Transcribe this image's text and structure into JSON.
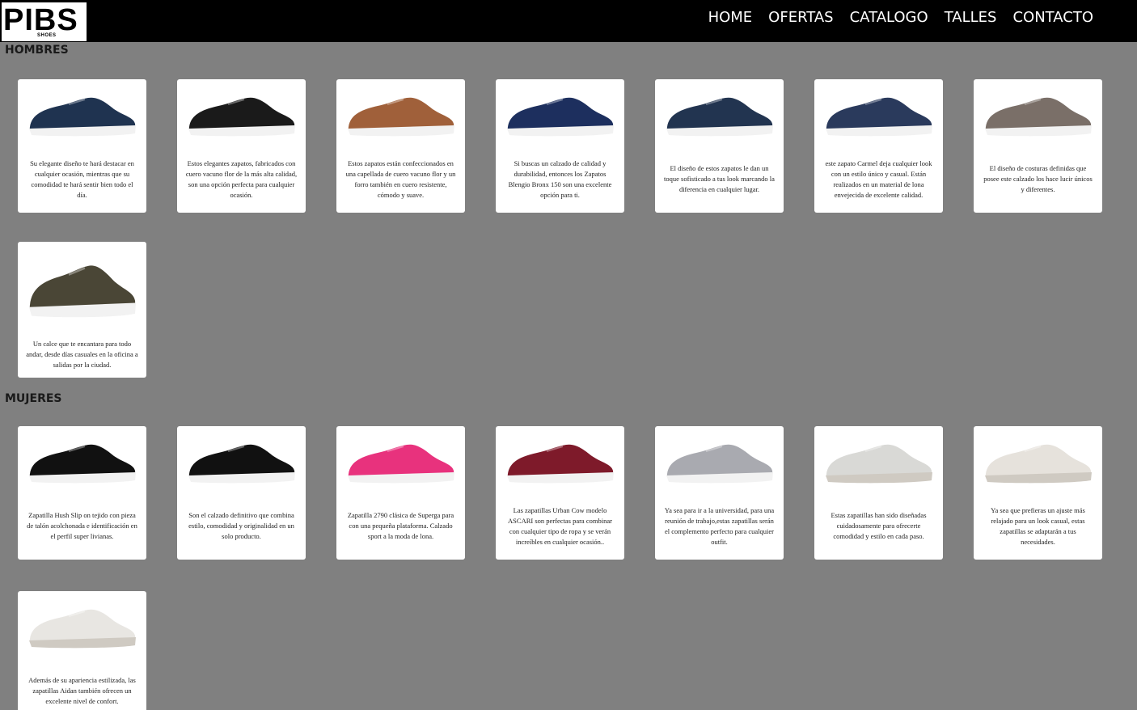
{
  "brand": {
    "logo_text": "PIBS",
    "logo_sub": "SHOES"
  },
  "nav": [
    "HOME",
    "OFERTAS",
    "CATALOGO",
    "TALLES",
    "CONTACTO"
  ],
  "sections": {
    "men": {
      "title": "HOMBRES",
      "products": [
        {
          "desc": "Su elegante diseño te hará destacar en cualquier ocasión, mientras que su comodidad te hará sentir bien todo el día.",
          "icon": "navy-sneaker-shoe",
          "color": "#1f3350"
        },
        {
          "desc": "Estos elegantes zapatos, fabricados con cuero vacuno flor de la más alta calidad, son una opción perfecta para cualquier ocasión.",
          "icon": "black-leather-shoe",
          "color": "#1a1a1a"
        },
        {
          "desc": "Estos zapatos están confeccionados en una capellada de cuero vacuno flor y un forro también en cuero resistente, cómodo y suave.",
          "icon": "brown-derby-shoe",
          "color": "#a0603a"
        },
        {
          "desc": "Si buscas un calzado de calidad y durabilidad, entonces los Zapatos Blengio Bronx 150 son una excelente opción para ti.",
          "icon": "blue-oxford-shoe",
          "color": "#1d2f5e"
        },
        {
          "desc": "El diseño de estos zapatos le dan un toque sofisticado a tus look marcando la diferencia en cualquier lugar.",
          "icon": "navy-loafer-shoe",
          "color": "#223450"
        },
        {
          "desc": "este zapato Carmel deja cualquier look con un estilo único y casual. Están realizados en un material de lona envejecida de excelente calidad.",
          "icon": "denim-slip-on-shoe",
          "color": "#2a3a5c"
        },
        {
          "desc": "El diseño de costuras definidas que posee este calzado los hace lucir únicos y diferentes.",
          "icon": "grey-suede-loafer",
          "color": "#7a6f68"
        },
        {
          "desc": "Un calce que te encantara para todo andar, desde días casuales en la oficina a salidas por la ciudad.",
          "icon": "olive-slip-on-shoe",
          "color": "#4a4636"
        }
      ]
    },
    "women": {
      "title": "MUJERES",
      "products": [
        {
          "desc": "Zapatilla Hush Slip on tejido con pieza de talón acolchonada e identificación en el perfil super livianas.",
          "icon": "black-mesh-clog",
          "color": "#111111"
        },
        {
          "desc": "Son el calzado definitivo que combina estilo, comodidad y originalidad en un solo producto.",
          "icon": "black-ballerina-shoe",
          "color": "#111111"
        },
        {
          "desc": "Zapatilla 2790 clásica de Superga para con una pequeña plataforma. Calzado sport a la moda de lona.",
          "icon": "pink-platform-sneaker",
          "color": "#e8327d"
        },
        {
          "desc": "Las zapatillas Urban Cow modelo ASCARI son perfectas para combinar con cualquier tipo de ropa y se verán increíbles en cualquier ocasión..",
          "icon": "burgundy-sneaker",
          "color": "#7e1a2a"
        },
        {
          "desc": "Ya sea para ir a la universidad, para una reunión de trabajo,estas zapatillas serán el complemento perfecto para cualquier outfit.",
          "icon": "grey-knit-sneaker",
          "color": "#a9aab0"
        },
        {
          "desc": "Estas zapatillas han sido diseñadas cuidadosamente para ofrecerte comodidad y estilo en cada paso.",
          "icon": "white-lace-sneaker",
          "color": "#d9d9d6"
        },
        {
          "desc": "Ya sea que prefieras un ajuste más relajado para un look casual, estas zapatillas se adaptarán a tus necesidades.",
          "icon": "white-perforated-sneaker",
          "color": "#e6e2dc"
        },
        {
          "desc": "Además de su apariencia estilizada, las zapatillas Aidan también ofrecen un excelente nivel de confort.",
          "icon": "white-floral-sneaker",
          "color": "#e8e6e2"
        }
      ]
    }
  }
}
